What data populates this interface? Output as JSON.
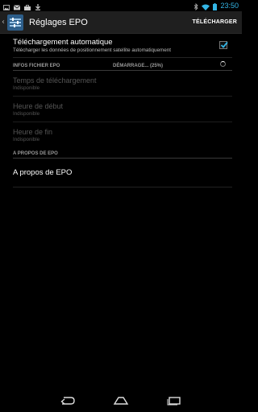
{
  "status_bar": {
    "time": "23:50",
    "left_icons": [
      "image-icon",
      "gmail-icon",
      "briefcase-icon",
      "download-icon"
    ],
    "right_icons": [
      "bluetooth-icon",
      "wifi-icon",
      "battery-icon"
    ]
  },
  "action_bar": {
    "title": "Réglages EPO",
    "action_label": "TÉLÉCHARGER"
  },
  "auto_download": {
    "title": "Téléchargement automatique",
    "summary": "Télécharger les données de positionnement satellite automatiquement",
    "checked": true
  },
  "epo_info": {
    "header": "INFOS FICHIER EPO",
    "status": "DÉMARRAGE... (25%)",
    "progress": 0.25,
    "items": [
      {
        "title": "Temps de téléchargement",
        "value": "Indisponible"
      },
      {
        "title": "Heure de début",
        "value": "Indisponible"
      },
      {
        "title": "Heure de fin",
        "value": "Indisponible"
      }
    ]
  },
  "about": {
    "header": "A PROPOS DE EPO",
    "item_label": "A propos de EPO"
  },
  "nav_bar": {
    "buttons": [
      "back-icon",
      "home-icon",
      "recent-apps-icon"
    ]
  },
  "colors": {
    "accent": "#33b5e5",
    "background": "#000000",
    "action_bar": "#1f1f1f"
  }
}
